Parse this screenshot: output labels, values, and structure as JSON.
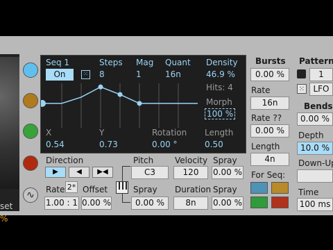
{
  "seq": {
    "title": "Seq 1",
    "toggle": "On",
    "steps_label": "Steps",
    "steps_value": "8",
    "mag_label": "Mag",
    "mag_value": "1",
    "quant_label": "Quant",
    "quant_value": "16n",
    "density_label": "Density",
    "density_value": "46.9 %",
    "hits_label": "Hits: 4",
    "morph_label": "Morph",
    "morph_value": "100 %",
    "x_label": "X",
    "x_value": "0.54",
    "y_label": "Y",
    "y_value": "0.73",
    "rotation_label": "Rotation",
    "rotation_value": "0.00 °",
    "length_label": "Length",
    "length_value": "0.50"
  },
  "direction": {
    "label": "Direction",
    "rate_label": "Rate",
    "rate_mult": "2*",
    "rate_value": "1.00 : 1",
    "offset_label": "Offset",
    "offset_value": "0.00 %"
  },
  "pitch": {
    "label": "Pitch",
    "value": "C3",
    "spray_label": "Spray",
    "spray_value": "0.00 %"
  },
  "velocity": {
    "label": "Velocity",
    "value": "120",
    "spray_label": "Spray",
    "spray_value": "0.00 %"
  },
  "duration": {
    "label": "Duration",
    "value": "8n",
    "spray_label": "Spray",
    "spray_value": "0.00 %"
  },
  "bursts": {
    "title": "Bursts",
    "value": "0.00 %",
    "rate_label": "Rate",
    "rate_value": "16n",
    "rate2_label": "Rate ??",
    "rate2_value": "0.00 %",
    "length_label": "Length",
    "length_value": "4n",
    "forseq_label": "For Seq:"
  },
  "patterns": {
    "title": "Patterns",
    "value": "1",
    "lfo_label": "LFO"
  },
  "bends": {
    "title": "Bends",
    "value": "0.00 %",
    "depth_label": "Depth",
    "depth_value": "10.0 %",
    "downup_label": "Down-Up",
    "time_label": "Time",
    "time_value": "100 ms"
  },
  "left_partial": {
    "label": "set",
    "value": "%"
  },
  "graph_points": [
    0.42,
    0.42,
    0.28,
    0.05,
    0.22,
    0.42,
    0.42,
    0.42,
    0.42
  ],
  "colors": {
    "dot1": "#5fc0ef",
    "dot2": "#b07a1e",
    "dot3": "#37a33a",
    "dot4": "#b02a10",
    "swatch1": "#4f92b8",
    "swatch2": "#b88a2a",
    "swatch3": "#2f9b3a",
    "swatch4": "#b0321c",
    "accent": "#9ad4f4"
  }
}
